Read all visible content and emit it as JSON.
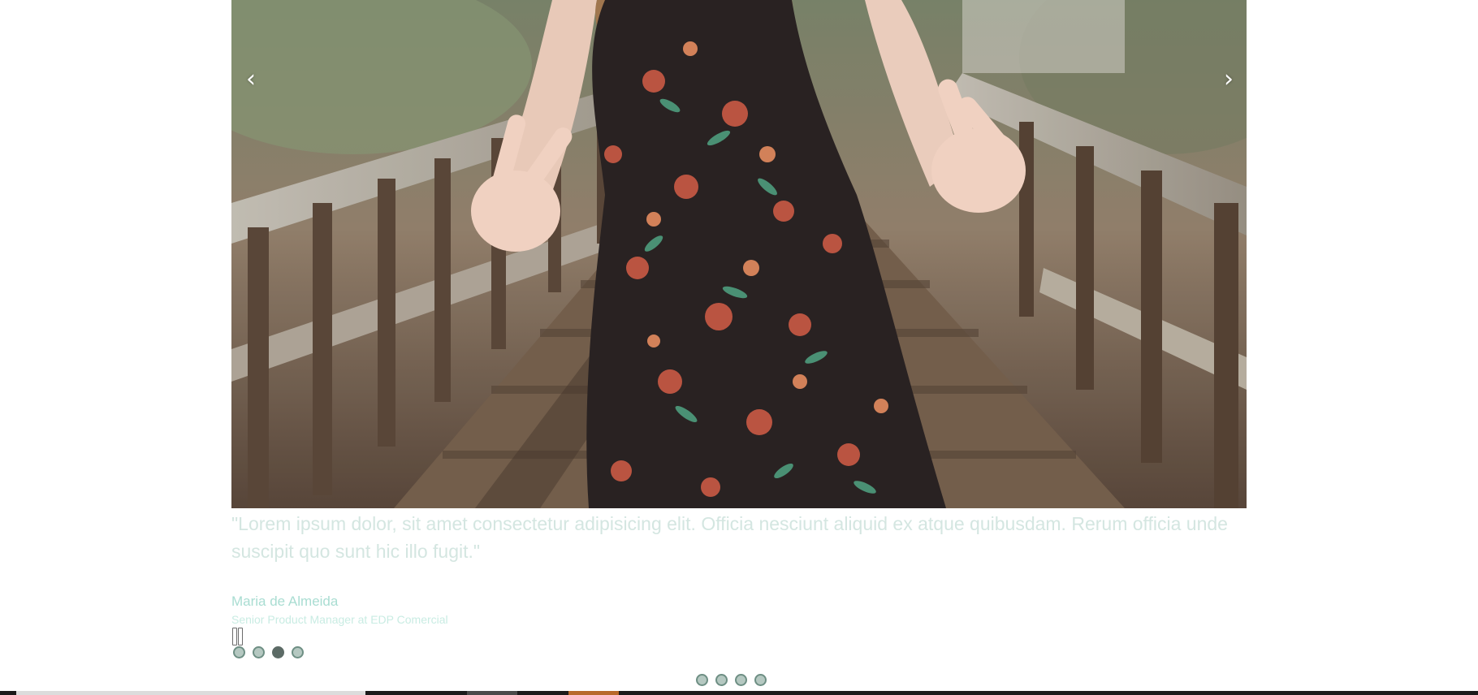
{
  "carousel": {
    "prev_glyph": "‹",
    "next_glyph": "›",
    "image_alt": "Person in floral dress making peace signs on a wooden bridge",
    "slide_count": 4,
    "active_index": 2
  },
  "testimonial": {
    "quote": "\"Lorem ipsum dolor, sit amet consectetur adipisicing elit. Officia nesciunt aliquid ex atque quibusdam. Rerum officia unde suscipit quo sunt hic illo fugit.\"",
    "author_name": "Maria de Almeida",
    "author_title": "Senior Product Manager at EDP Comercial"
  },
  "secondary_pagination": {
    "slide_count": 4
  },
  "colors": {
    "quote_text": "#d4e6e1",
    "author_name": "#a9ddd2",
    "author_title": "#c9ece3",
    "dot_inactive": "#b5c8c1",
    "dot_active": "#5c6b66"
  },
  "icons": {
    "prev": "chevron-left-icon",
    "next": "chevron-right-icon",
    "pause": "pause-icon"
  }
}
